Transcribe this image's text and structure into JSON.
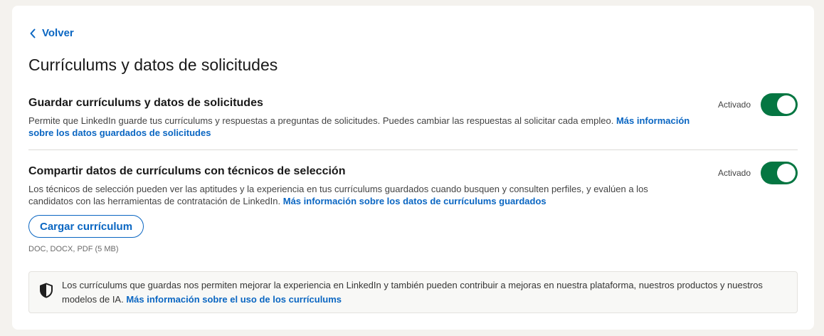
{
  "back": {
    "label": "Volver"
  },
  "page": {
    "title": "Currículums y datos de solicitudes"
  },
  "settings": [
    {
      "heading": "Guardar currículums y datos de solicitudes",
      "description": "Permite que LinkedIn guarde tus currículums y respuestas a preguntas de solicitudes. Puedes cambiar las respuestas al solicitar cada empleo.",
      "link": "Más información sobre los datos guardados de solicitudes",
      "status": "Activado",
      "enabled": true
    },
    {
      "heading": "Compartir datos de currículums con técnicos de selección",
      "description": "Los técnicos de selección pueden ver las aptitudes y la experiencia en tus currículums guardados cuando busquen y consulten perfiles, y evalúen a los candidatos con las herramientas de contratación de LinkedIn.",
      "link": "Más información sobre los datos de currículums guardados",
      "status": "Activado",
      "enabled": true
    }
  ],
  "upload": {
    "button_label": "Cargar currículum",
    "formats": "DOC, DOCX, PDF (5 MB)"
  },
  "info": {
    "text": "Los currículums que guardas nos permiten mejorar la experiencia en LinkedIn y también pueden contribuir a mejoras en nuestra plataforma, nuestros productos y nuestros modelos de IA.",
    "link": "Más información sobre el uso de los currículums",
    "icon": "shield-icon"
  },
  "colors": {
    "accent": "#0a66c2",
    "toggle_on": "#057642",
    "background": "#f4f2ee"
  }
}
